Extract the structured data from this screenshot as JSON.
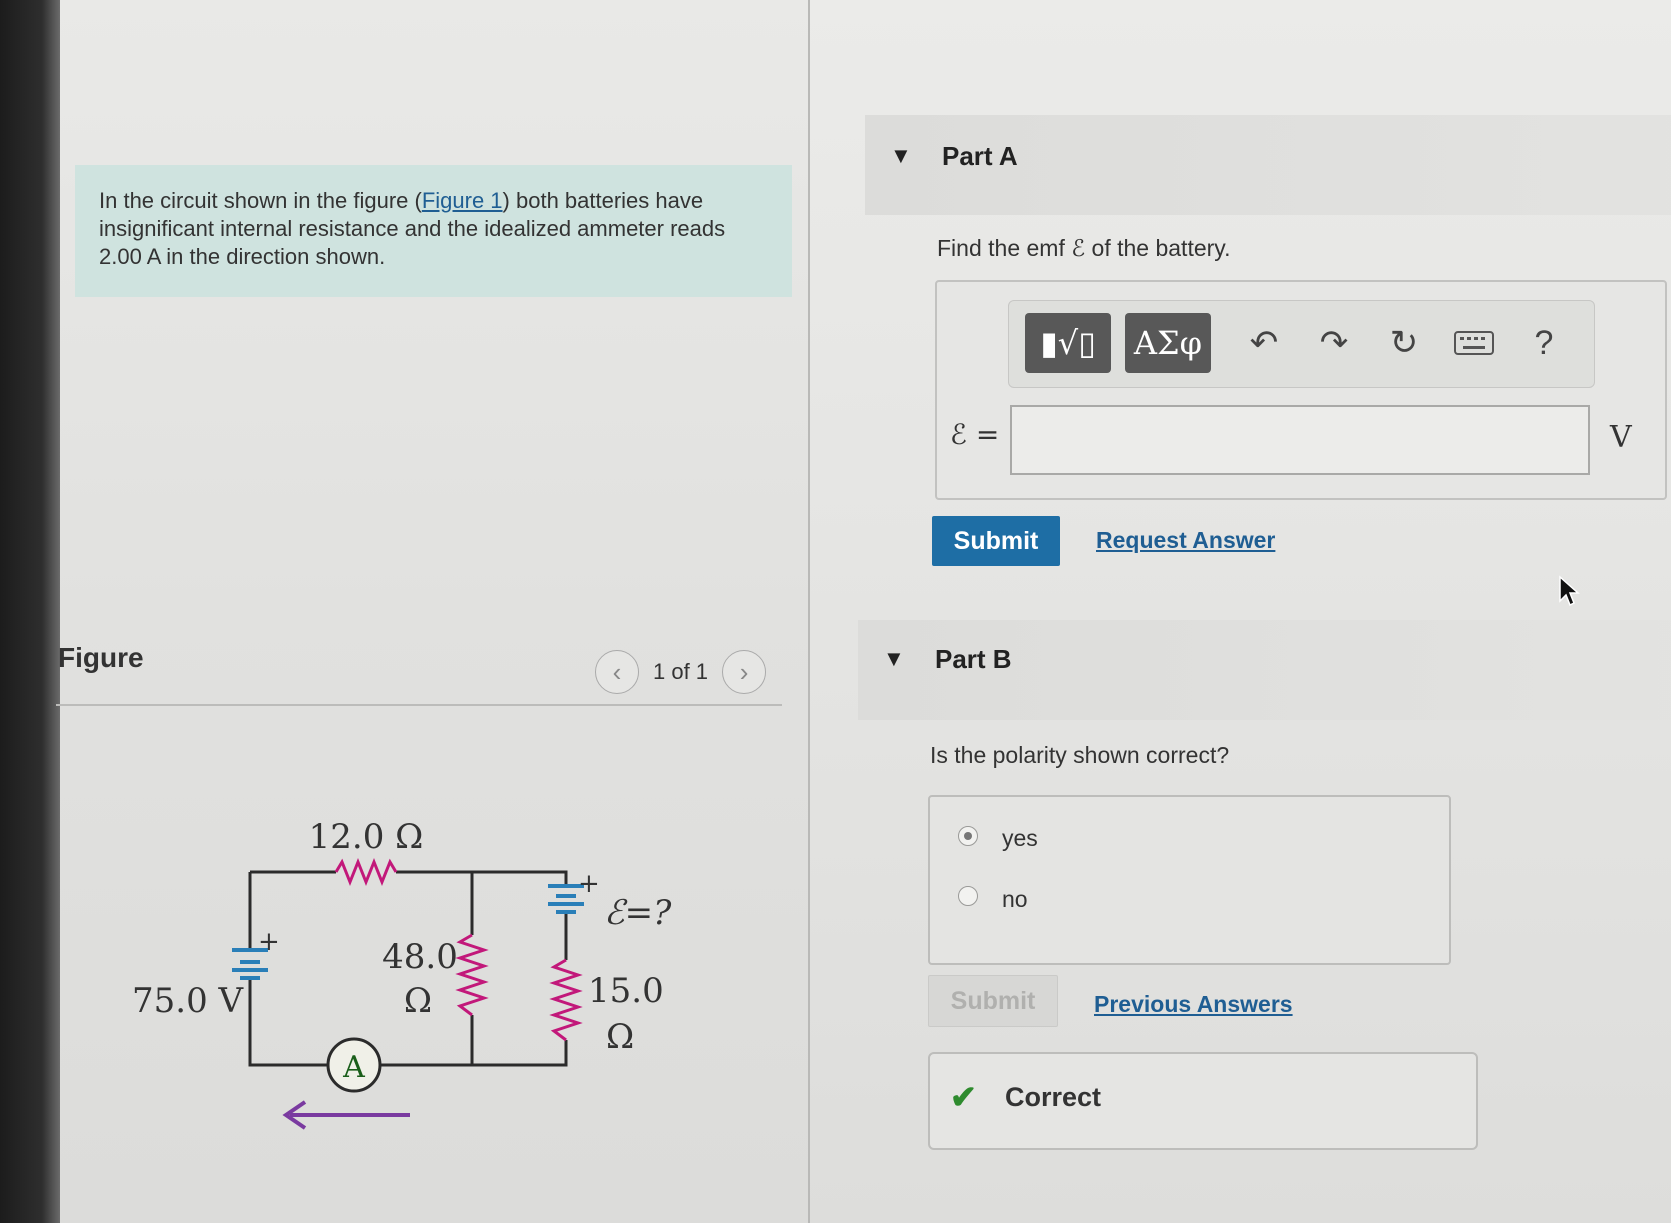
{
  "problem": {
    "text_before": "In the circuit shown in the figure (",
    "figure_link": "Figure 1",
    "text_after": ") both batteries have insignificant internal resistance and the idealized ammeter reads 2.00 A in the direction shown."
  },
  "figure": {
    "title": "Figure",
    "pager_text": "1 of 1",
    "prev_icon": "chevron-left-icon",
    "next_icon": "chevron-right-icon",
    "circuit": {
      "r_top": "12.0 Ω",
      "r_mid_value": "48.0",
      "r_mid_unit": "Ω",
      "r_right_value": "15.0",
      "r_right_unit": "Ω",
      "battery_left": "75.0 V",
      "battery_right": "ℰ=?",
      "plus": "+",
      "ammeter": "A",
      "wire_color": "#2b2b2b",
      "resistor_color": "#c2187a",
      "arrow_color": "#7a3aa0"
    }
  },
  "part_a": {
    "label": "Part A",
    "prompt": "Find the emf ℰ of the battery.",
    "toolbar": {
      "template_btn": "▮√▯",
      "greek_btn": "ΑΣφ",
      "undo_icon": "undo-icon",
      "redo_icon": "redo-icon",
      "reset_icon": "reset-icon",
      "keyboard_icon": "keyboard-icon",
      "help": "?"
    },
    "input_label": "ℰ =",
    "input_value": "",
    "unit": "V",
    "submit": "Submit",
    "request_answer": "Request Answer"
  },
  "part_b": {
    "label": "Part B",
    "prompt": "Is the polarity shown correct?",
    "options": [
      {
        "label": "yes",
        "checked": true
      },
      {
        "label": "no",
        "checked": false
      }
    ],
    "submit": "Submit",
    "previous_answers": "Previous Answers",
    "result": "Correct",
    "result_icon": "checkmark-icon"
  }
}
